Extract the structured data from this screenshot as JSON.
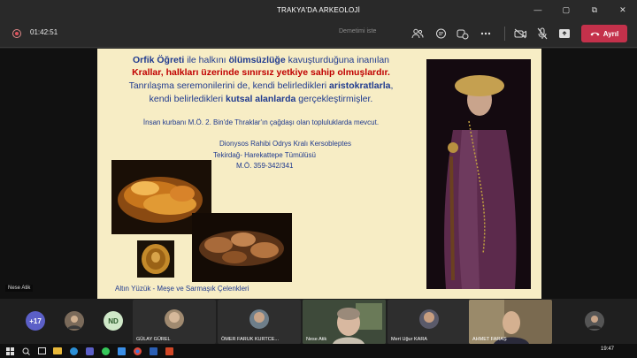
{
  "window": {
    "title": "TRAKYA'DA ARKEOLOJİ",
    "controls": [
      "—",
      "▢",
      "⧉",
      "✕"
    ]
  },
  "toolbar": {
    "timer": "01:42:51",
    "try_label": "Demetimi iste",
    "leave_label": "Ayrıl",
    "icons": [
      "people-icon",
      "chat-icon",
      "reactions-icon",
      "more-icon",
      "camera-off-icon",
      "mic-off-icon",
      "share-icon"
    ]
  },
  "slide": {
    "line1_a": "Orfik Öğreti",
    "line1_b": " ile halkını ",
    "line1_c": "ölümsüzlüğe",
    "line1_d": " kavuşturduğuna inanılan",
    "line2": "Krallar, halkları üzerinde sınırsız yetkiye sahip olmuşlardır.",
    "line3_a": "Tanrılaşma seremonilerini de, kendi belirledikleri ",
    "line3_b": "aristokratlarla",
    "line3_c": ",",
    "line4_a": "kendi belirledikleri ",
    "line4_b": "kutsal alanlarda",
    "line4_c": " gerçekleştirmişler.",
    "note": "İnsan kurbanı M.Ö. 2. Bin'de Thraklar'ın çağdaşı olan topluluklarda mevcut.",
    "info1": "Dionysos Rahibi Odrys Kralı Kersobleptes",
    "info2": "Tekirdağ- Harekattepe Tümülüsü",
    "info3": "M.Ö. 359-342/341",
    "caption": "Altın Yüzük - Meşe ve Sarmaşık Çelenkleri"
  },
  "presenter": "Nese Atik",
  "participants": {
    "overflow": "+17",
    "initials": "ND",
    "tiles": [
      {
        "name": "GÜLAY GÜREL"
      },
      {
        "name": "ÖMER FARUK KURTCE..."
      },
      {
        "name": "Nese Atik"
      },
      {
        "name": "Mert Uğur KARA"
      },
      {
        "name": "AHMET FARAŞ"
      }
    ]
  },
  "taskbar": {
    "clock": "19:47"
  }
}
